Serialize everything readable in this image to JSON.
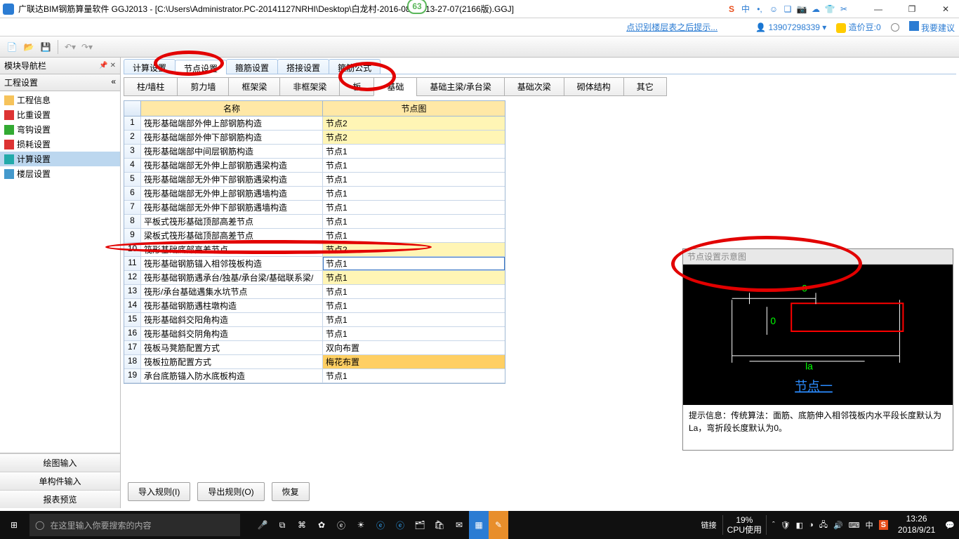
{
  "title": "广联达BIM钢筋算量软件 GGJ2013 - [C:\\Users\\Administrator.PC-20141127NRHI\\Desktop\\白龙村-2016-08-25-13-27-07(2166版).GGJ]",
  "badge": "63",
  "ime_icons": [
    "中",
    "•,",
    "☺",
    "❑",
    "📷",
    "☁",
    "👕",
    "✂"
  ],
  "win_ctl": [
    "—",
    "❐",
    "✕"
  ],
  "tip_text": "点识别楼层表之后提示...",
  "user_phone": "13907298339 ▾",
  "credit_label": "造价豆:0",
  "feedback_label": "我要建议",
  "nav_panel": {
    "title": "模块导航栏",
    "sub": "工程设置"
  },
  "tree": [
    {
      "label": "工程信息",
      "icon": "ic-folder"
    },
    {
      "label": "比重设置",
      "icon": "ic-red"
    },
    {
      "label": "弯钩设置",
      "icon": "ic-green"
    },
    {
      "label": "损耗设置",
      "icon": "ic-red"
    },
    {
      "label": "计算设置",
      "icon": "ic-teal",
      "sel": true
    },
    {
      "label": "楼层设置",
      "icon": "ic-blue"
    }
  ],
  "side_buttons": [
    "绘图输入",
    "单构件输入",
    "报表预览"
  ],
  "top_tabs": [
    "计算设置",
    "节点设置",
    "箍筋设置",
    "搭接设置",
    "箍筋公式"
  ],
  "top_active": 1,
  "sub_tabs": [
    "柱/墙柱",
    "剪力墙",
    "框架梁",
    "非框架梁",
    "板",
    "基础",
    "基础主梁/承台梁",
    "基础次梁",
    "砌体结构",
    "其它"
  ],
  "sub_active": 5,
  "grid_headers": {
    "c1": "名称",
    "c2": "节点图"
  },
  "rows": [
    {
      "n": "1",
      "name": "筏形基础端部外伸上部钢筋构造",
      "val": "节点2",
      "y": true
    },
    {
      "n": "2",
      "name": "筏形基础端部外伸下部钢筋构造",
      "val": "节点2",
      "y": true
    },
    {
      "n": "3",
      "name": "筏形基础端部中间层钢筋构造",
      "val": "节点1"
    },
    {
      "n": "4",
      "name": "筏形基础端部无外伸上部钢筋遇梁构造",
      "val": "节点1"
    },
    {
      "n": "5",
      "name": "筏形基础端部无外伸下部钢筋遇梁构造",
      "val": "节点1"
    },
    {
      "n": "6",
      "name": "筏形基础端部无外伸上部钢筋遇墙构造",
      "val": "节点1"
    },
    {
      "n": "7",
      "name": "筏形基础端部无外伸下部钢筋遇墙构造",
      "val": "节点1"
    },
    {
      "n": "8",
      "name": "平板式筏形基础顶部高差节点",
      "val": "节点1"
    },
    {
      "n": "9",
      "name": "梁板式筏形基础顶部高差节点",
      "val": "节点1"
    },
    {
      "n": "10",
      "name": "筏形基础底部高差节点",
      "val": "节点2",
      "y": true
    },
    {
      "n": "11",
      "name": "筏形基础钢筋锚入相邻筏板构造",
      "val": "节点1",
      "sel": true
    },
    {
      "n": "12",
      "name": "筏形基础钢筋遇承台/独基/承台梁/基础联系梁/",
      "val": "节点1",
      "y": true
    },
    {
      "n": "13",
      "name": "筏形/承台基础遇集水坑节点",
      "val": "节点1"
    },
    {
      "n": "14",
      "name": "筏形基础钢筋遇柱墩构造",
      "val": "节点1"
    },
    {
      "n": "15",
      "name": "筏形基础斜交阳角构造",
      "val": "节点1"
    },
    {
      "n": "16",
      "name": "筏形基础斜交阴角构造",
      "val": "节点1"
    },
    {
      "n": "17",
      "name": "筏板马凳筋配置方式",
      "val": "双向布置"
    },
    {
      "n": "18",
      "name": "筏板拉筋配置方式",
      "val": "梅花布置",
      "o": true
    },
    {
      "n": "19",
      "name": "承台底筋锚入防水底板构造",
      "val": "节点1"
    }
  ],
  "bottom_buttons": [
    "导入规则(I)",
    "导出规则(O)",
    "恢复"
  ],
  "preview": {
    "title": "节点设置示意图",
    "tip_label": "提示信息：",
    "tip_text": "传统算法：面筋、底筋伸入相邻筏板内水平段长度默认为La，弯折段长度默认为0。",
    "diag": {
      "v1": "0",
      "v2": "0",
      "v3": "la",
      "title": "节点一"
    }
  },
  "taskbar": {
    "search_placeholder": "在这里输入你要搜索的内容",
    "link_label": "链接",
    "cpu_pct": "19%",
    "cpu_label": "CPU使用",
    "time": "13:26",
    "date": "2018/9/21",
    "ime": "中"
  }
}
